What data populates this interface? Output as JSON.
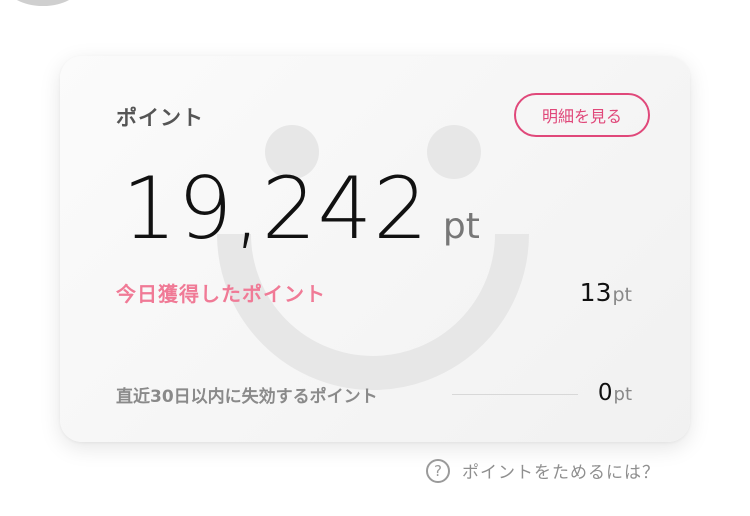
{
  "card": {
    "title": "ポイント",
    "details_button_label": "明細を見る",
    "points_value": "19,242",
    "points_unit": "pt",
    "today_label": "今日獲得したポイント",
    "today_value": "13",
    "today_unit": "pt",
    "expiring_label": "直近30日以内に失効するポイント",
    "expiring_value": "0",
    "expiring_unit": "pt"
  },
  "help": {
    "icon_glyph": "?",
    "link_text": "ポイントをためるには？"
  },
  "colors": {
    "accent_pink": "#e0487a",
    "today_label_pink": "#f07a96",
    "card_background": "#f5f5f5",
    "watermark_gray": "#e6e6e6"
  },
  "icons": {
    "watermark": "smiley-face-icon",
    "help": "question-circle-icon"
  }
}
